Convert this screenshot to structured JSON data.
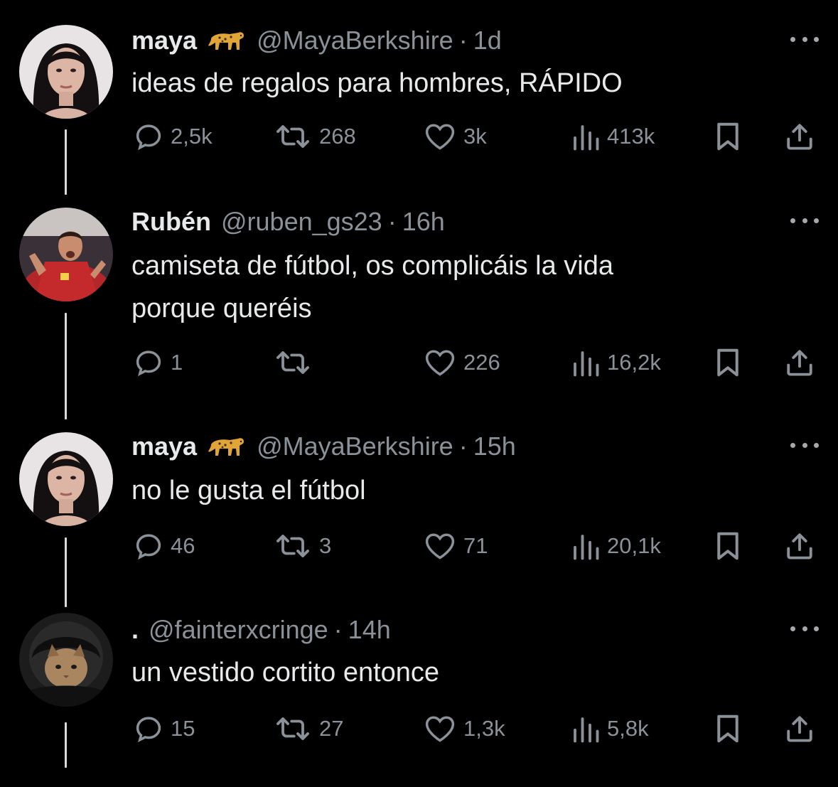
{
  "tweets": [
    {
      "name": "maya",
      "has_badge": true,
      "handle": "@MayaBerkshire",
      "time": "1d",
      "text": "ideas de regalos para hombres, RÁPIDO",
      "replies": "2,5k",
      "retweets": "268",
      "likes": "3k",
      "views": "413k"
    },
    {
      "name": "Rubén",
      "has_badge": false,
      "handle": "@ruben_gs23",
      "time": "16h",
      "text": "camiseta de fútbol, os complicáis la vida\nporque queréis",
      "replies": "1",
      "retweets": "",
      "likes": "226",
      "views": "16,2k"
    },
    {
      "name": "maya",
      "has_badge": true,
      "handle": "@MayaBerkshire",
      "time": "15h",
      "text": "no le gusta el fútbol",
      "replies": "46",
      "retweets": "3",
      "likes": "71",
      "views": "20,1k"
    },
    {
      "name": ".",
      "has_badge": false,
      "handle": "@fainterxcringe",
      "time": "14h",
      "text": "un vestido cortito entonce",
      "replies": "15",
      "retweets": "27",
      "likes": "1,3k",
      "views": "5,8k"
    }
  ],
  "separator": "·",
  "icons": {
    "avatar_1": "avatar-woman-dark-hair",
    "avatar_2": "avatar-football-player-red-shirt",
    "avatar_3": "avatar-woman-dark-hair",
    "avatar_4": "avatar-cat-helmet",
    "badge": "cheetah-emoji-icon",
    "more": "more-icon",
    "reply": "reply-icon",
    "retweet": "retweet-icon",
    "like": "like-icon",
    "views": "views-icon",
    "bookmark": "bookmark-icon",
    "share": "share-icon"
  },
  "colors": {
    "background": "#000000",
    "text": "#e7e9ea",
    "secondary": "#8b9198",
    "thread_line": "#d9d9d9"
  }
}
